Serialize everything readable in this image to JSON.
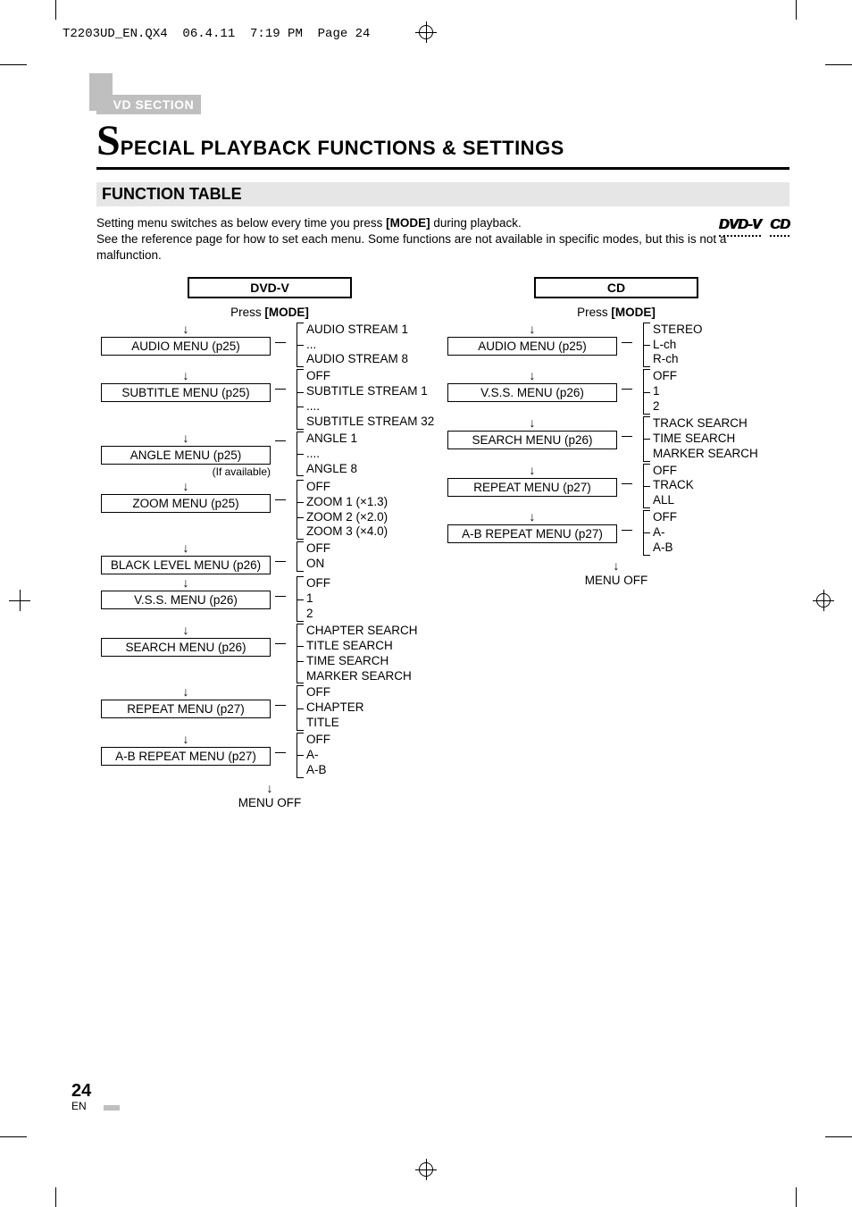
{
  "slug": "T2203UD_EN.QX4  06.4.11  7:19 PM  Page 24",
  "section_tag": "DVD SECTION",
  "title_initial": "S",
  "title_rest": "PECIAL PLAYBACK FUNCTIONS & SETTINGS",
  "subhead": "FUNCTION TABLE",
  "intro_line1_a": "Setting menu switches as below every time you press ",
  "intro_line1_b": "[MODE]",
  "intro_line1_c": " during playback.",
  "intro_line2": "See the reference page for how to set each menu. Some functions are not available in specific modes, but this is not a malfunction.",
  "badge1": "DVD-V",
  "badge2": "CD",
  "dvdv": {
    "heading": "DVD-V",
    "press_a": "Press ",
    "press_b": "[MODE]",
    "menus": [
      {
        "label": "AUDIO MENU (p25)",
        "opts": [
          "AUDIO STREAM 1",
          "...",
          "AUDIO STREAM 8"
        ]
      },
      {
        "label": "SUBTITLE MENU (p25)",
        "opts": [
          "OFF",
          "SUBTITLE STREAM 1",
          "....",
          "SUBTITLE STREAM 32"
        ]
      },
      {
        "label": "ANGLE MENU (p25)",
        "note": "(If available)",
        "opts": [
          "ANGLE 1",
          "....",
          "ANGLE 8"
        ]
      },
      {
        "label": "ZOOM MENU (p25)",
        "opts": [
          "OFF",
          "ZOOM 1 (×1.3)",
          "ZOOM 2 (×2.0)",
          "ZOOM 3 (×4.0)"
        ]
      },
      {
        "label": "BLACK LEVEL MENU (p26)",
        "opts": [
          "OFF",
          "ON"
        ]
      },
      {
        "label": "V.S.S. MENU (p26)",
        "opts": [
          "OFF",
          "1",
          "2"
        ]
      },
      {
        "label": "SEARCH MENU (p26)",
        "opts": [
          "CHAPTER SEARCH",
          "TITLE SEARCH",
          "TIME SEARCH",
          "MARKER SEARCH"
        ]
      },
      {
        "label": "REPEAT MENU (p27)",
        "opts": [
          "OFF",
          "CHAPTER",
          "TITLE"
        ]
      },
      {
        "label": "A-B REPEAT MENU (p27)",
        "opts": [
          "OFF",
          "A-",
          "A-B"
        ]
      }
    ],
    "off": "MENU OFF"
  },
  "cd": {
    "heading": "CD",
    "press_a": "Press ",
    "press_b": "[MODE]",
    "menus": [
      {
        "label": "AUDIO MENU (p25)",
        "opts": [
          "STEREO",
          "L-ch",
          "R-ch"
        ]
      },
      {
        "label": "V.S.S. MENU (p26)",
        "opts": [
          "OFF",
          "1",
          "2"
        ]
      },
      {
        "label": "SEARCH MENU (p26)",
        "opts": [
          "TRACK SEARCH",
          "TIME SEARCH",
          "MARKER SEARCH"
        ]
      },
      {
        "label": "REPEAT MENU (p27)",
        "opts": [
          "OFF",
          "TRACK",
          "ALL"
        ]
      },
      {
        "label": "A-B REPEAT MENU (p27)",
        "opts": [
          "OFF",
          "A-",
          "A-B"
        ]
      }
    ],
    "off": "MENU OFF"
  },
  "page_number": "24",
  "page_lang": "EN"
}
